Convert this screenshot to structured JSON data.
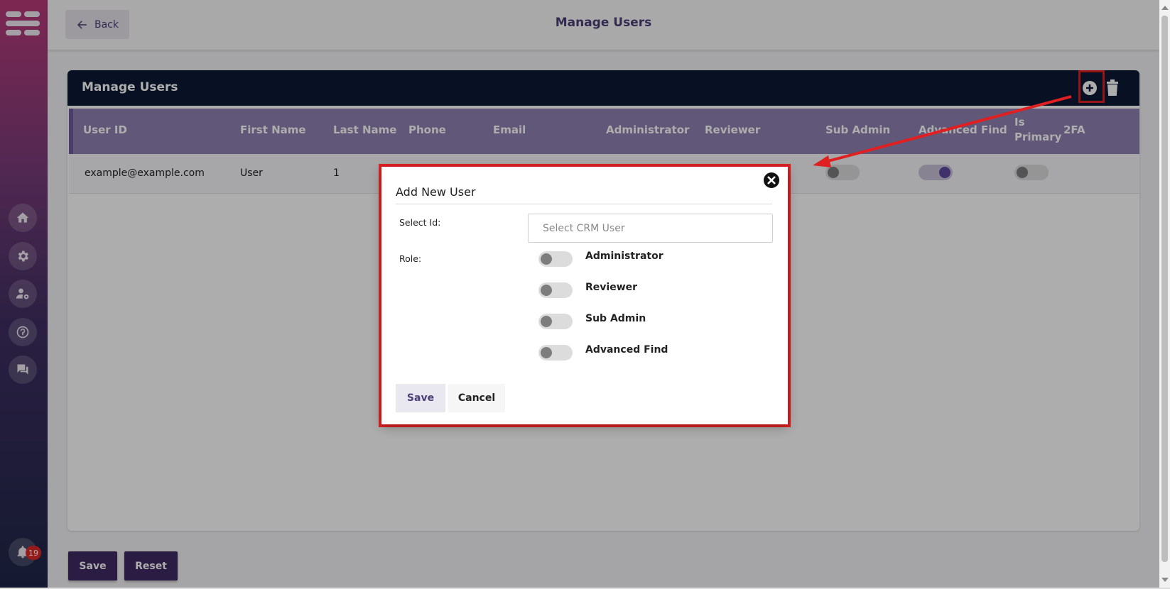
{
  "topbar": {
    "back_label": "Back",
    "title": "Manage Users"
  },
  "card": {
    "title": "Manage Users"
  },
  "table": {
    "headers": {
      "user_id": "User ID",
      "first_name": "First Name",
      "last_name": "Last Name",
      "phone": "Phone",
      "email": "Email",
      "administrator": "Administrator",
      "reviewer": "Reviewer",
      "sub_admin": "Sub Admin",
      "advanced_find": "Advanced Find",
      "is_primary_1": "Is",
      "is_primary_2": "Primary",
      "twofa": "2FA"
    },
    "row": {
      "user_id": "example@example.com",
      "first_name": "User",
      "last_name": "1",
      "sub_admin": false,
      "advanced_find": true,
      "is_primary": false
    }
  },
  "footer": {
    "save_label": "Save",
    "reset_label": "Reset"
  },
  "notifications": {
    "count": "19"
  },
  "modal": {
    "title": "Add New User",
    "select_id_label": "Select Id:",
    "select_placeholder": "Select CRM User",
    "role_label": "Role:",
    "roles": [
      "Administrator",
      "Reviewer",
      "Sub Admin",
      "Advanced Find"
    ],
    "save_label": "Save",
    "cancel_label": "Cancel"
  },
  "colors": {
    "header_navy": "#0c1a35",
    "table_header": "#9080b3",
    "primary_purple": "#3e2a62",
    "annotation_red": "#e02020"
  }
}
